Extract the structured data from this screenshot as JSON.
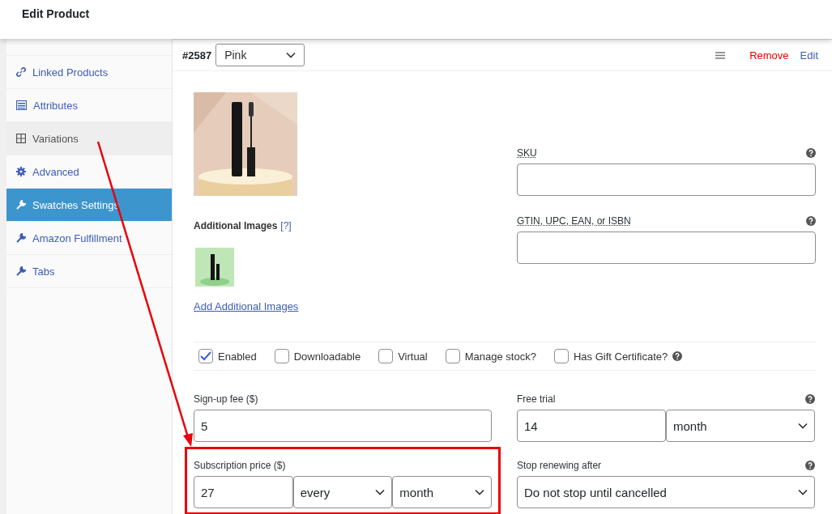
{
  "header": {
    "title": "Edit Product"
  },
  "sidebar": {
    "items": [
      {
        "label": "Linked Products",
        "selected": false,
        "hovered": false
      },
      {
        "label": "Attributes",
        "selected": false,
        "hovered": false
      },
      {
        "label": "Variations",
        "selected": false,
        "hovered": true
      },
      {
        "label": "Advanced",
        "selected": false,
        "hovered": false
      },
      {
        "label": "Swatches Settings",
        "selected": true,
        "hovered": false
      },
      {
        "label": "Amazon Fulfillment",
        "selected": false,
        "hovered": false
      },
      {
        "label": "Tabs",
        "selected": false,
        "hovered": false
      }
    ]
  },
  "variation": {
    "id": "#2587",
    "attribute": "Pink",
    "actions": [
      {
        "label": "Remove",
        "kind": "danger"
      },
      {
        "label": "Edit",
        "kind": "link"
      }
    ],
    "additional_images": {
      "label": "Additional Images",
      "help": "[?]",
      "add_link": "Add Additional Images"
    },
    "sku": {
      "label": "SKU"
    },
    "gtin": {
      "label": "GTIN, UPC, EAN, or ISBN"
    },
    "options": [
      {
        "label": "Enabled",
        "checked": true,
        "help": false
      },
      {
        "label": "Downloadable",
        "checked": false,
        "help": false
      },
      {
        "label": "Virtual",
        "checked": false,
        "help": false
      },
      {
        "label": "Manage stock?",
        "checked": false,
        "help": false
      },
      {
        "label": "Has Gift Certificate?",
        "checked": false,
        "help": true
      }
    ],
    "signup_fee": {
      "label": "Sign-up fee ($)",
      "value": "5"
    },
    "free_trial": {
      "label": "Free trial",
      "value": "14",
      "period": "month"
    },
    "subscription_price": {
      "label": "Subscription price ($)",
      "value": "27",
      "interval": "every",
      "period": "month",
      "highlighted": true
    },
    "stop_renewing": {
      "label": "Stop renewing after",
      "value": "Do not stop until cancelled"
    }
  }
}
